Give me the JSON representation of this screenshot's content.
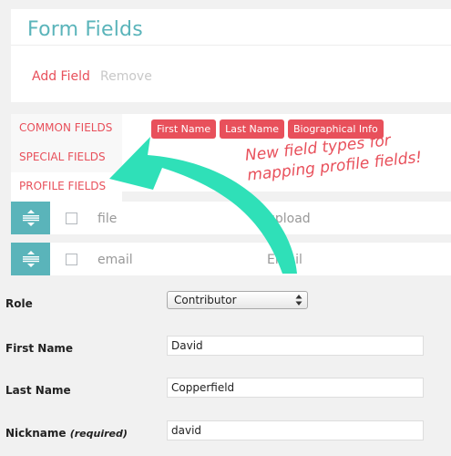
{
  "panel": {
    "title": "Form Fields",
    "add_label": "Add Field",
    "remove_label": "Remove"
  },
  "field_types": {
    "tabs": [
      {
        "label": "COMMON FIELDS",
        "active": false
      },
      {
        "label": "SPECIAL FIELDS",
        "active": false
      },
      {
        "label": "PROFILE FIELDS",
        "active": true
      }
    ],
    "chips": [
      "First Name",
      "Last Name",
      "Biographical Info"
    ]
  },
  "field_rows": [
    {
      "name": "file",
      "type": "upload",
      "handle_icon": "drag-handle-icon"
    },
    {
      "name": "email",
      "type": "Email",
      "handle_icon": "drag-handle-icon"
    }
  ],
  "annotation": {
    "lines": [
      "New field types for",
      "mapping profile fields!"
    ]
  },
  "profile_form": {
    "role_label": "Role",
    "role_value": "Contributor",
    "first_name_label": "First Name",
    "first_name_value": "David",
    "last_name_label": "Last Name",
    "last_name_value": "Copperfield",
    "nickname_label": "Nickname",
    "nickname_required": "(required)",
    "nickname_value": "david"
  },
  "colors": {
    "accent_teal": "#5ab4ba",
    "accent_red": "#e8505b",
    "arrow": "#2fe0b8"
  }
}
